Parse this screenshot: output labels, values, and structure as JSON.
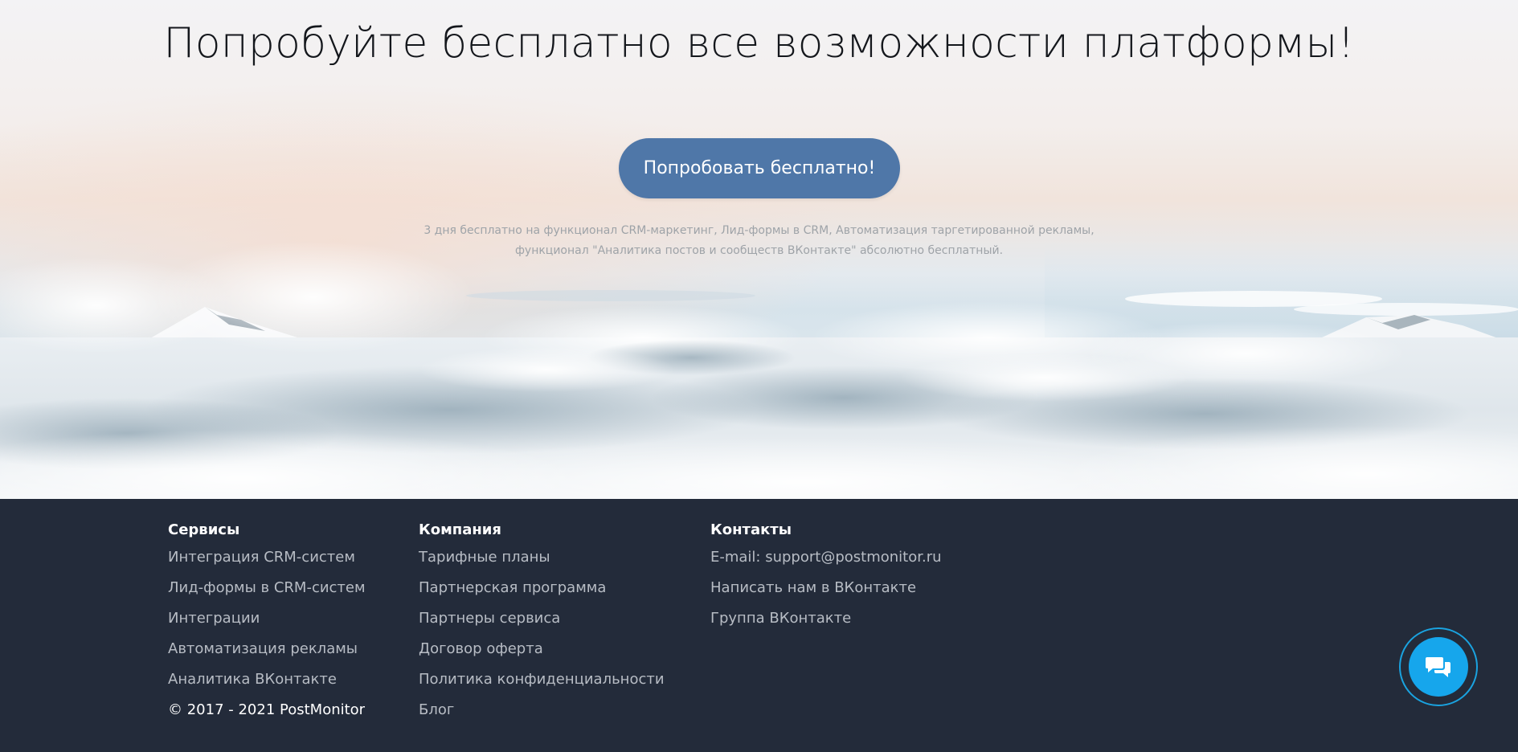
{
  "hero": {
    "title": "Попробуйте бесплатно все возможности платформы!",
    "cta_label": "Попробовать бесплатно!",
    "note_line1": "3 дня бесплатно на функционал CRM-маркетинг, Лид-формы в CRM, Автоматизация таргетированной рекламы,",
    "note_line2": "функционал \"Аналитика постов и сообществ ВКонтакте\" абсолютно бесплатный."
  },
  "footer": {
    "services": {
      "heading": "Сервисы",
      "links": [
        "Интеграция CRM-систем",
        "Лид-формы в CRM-систем",
        "Интеграции",
        "Автоматизация рекламы",
        "Аналитика ВКонтакте"
      ],
      "copyright": "© 2017 - 2021 PostMonitor"
    },
    "company": {
      "heading": "Компания",
      "links": [
        "Тарифные планы",
        "Партнерская программа",
        "Партнеры сервиса",
        "Договор оферта",
        "Политика конфиденциальности",
        "Блог"
      ]
    },
    "contacts": {
      "heading": "Контакты",
      "links": [
        "E-mail: support@postmonitor.ru",
        "Написать нам в ВКонтакте",
        "Группа ВКонтакте"
      ]
    }
  },
  "chat_widget": {
    "icon": "chat-bubbles-icon"
  },
  "colors": {
    "footer_bg": "#232b3a",
    "cta_bg": "#4f77a8",
    "chat_accent": "#16a6ec"
  }
}
